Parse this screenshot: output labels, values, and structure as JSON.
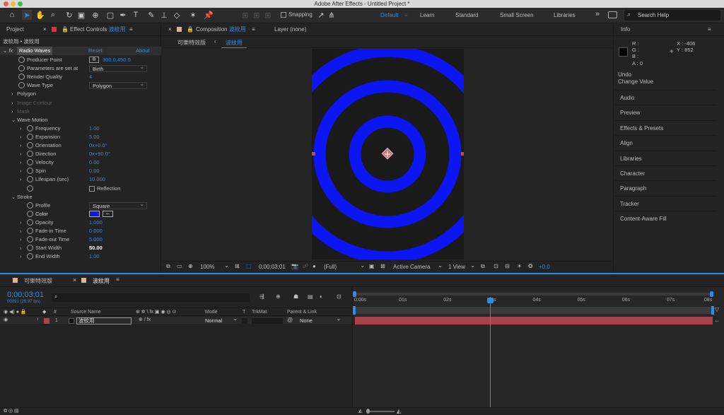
{
  "window": {
    "title": "Adobe After Effects - Untitled Project *"
  },
  "toolbar": {
    "snapping": "Snapping",
    "workspaces": [
      "Default",
      "Learn",
      "Standard",
      "Small Screen",
      "Libraries"
    ],
    "more": "»",
    "search": "Search Help"
  },
  "project_tab": "Project",
  "effect_tab": {
    "prefix": "Effect Controls",
    "comp": "波紋用"
  },
  "comp_panel": {
    "tab_prefix": "Composition",
    "tab_name": "波紋用",
    "layer": "Layer (none)",
    "breadcrumb": [
      "可樂特效版",
      "波紋用"
    ]
  },
  "effect": {
    "header": "波紋用 • 波紋用",
    "name": "Radio Waves",
    "reset": "Reset",
    "about": "About",
    "rows": [
      {
        "label": "Producer Point",
        "value": "300.0,450.0"
      },
      {
        "label": "Parameters are set at",
        "value": "Birth"
      },
      {
        "label": "Render Quality",
        "value": "4"
      },
      {
        "label": "Wave Type",
        "value": "Polygon"
      },
      {
        "label": "Polygon"
      },
      {
        "label": "Image Contour"
      },
      {
        "label": "Mask"
      },
      {
        "label": "Wave Motion"
      },
      {
        "label": "Frequency",
        "value": "1.00"
      },
      {
        "label": "Expansion",
        "value": "5.00"
      },
      {
        "label": "Orientation",
        "value": "0x+0.0°"
      },
      {
        "label": "Direction",
        "value": "0x+90.0°"
      },
      {
        "label": "Velocity",
        "value": "0.00"
      },
      {
        "label": "Spin",
        "value": "0.00"
      },
      {
        "label": "Lifespan (sec)",
        "value": "10.000"
      },
      {
        "label": "Reflection"
      },
      {
        "label": "Stroke"
      },
      {
        "label": "Profile",
        "value": "Square"
      },
      {
        "label": "Color"
      },
      {
        "label": "Opacity",
        "value": "1.000"
      },
      {
        "label": "Fade-in Time",
        "value": "0.000"
      },
      {
        "label": "Fade-out Time",
        "value": "5.000"
      },
      {
        "label": "Start Width",
        "value": "50.00"
      },
      {
        "label": "End Width",
        "value": "1.00"
      }
    ]
  },
  "viewer": {
    "zoom": "100%",
    "timecode": "0;00;03;01",
    "resolution": "(Full)",
    "camera": "Active Camera",
    "view": "1 View",
    "exposure": "+0.0"
  },
  "info": {
    "title": "Info",
    "r": "R :",
    "g": "G :",
    "b": "B :",
    "a": "A :  0",
    "x": "X : -406",
    "y": "Y :  852",
    "undo": "Undo",
    "undo_action": "Change Value"
  },
  "right_panels": [
    "Audio",
    "Preview",
    "Effects & Presets",
    "Align",
    "Libraries",
    "Character",
    "Paragraph",
    "Tracker",
    "Content-Aware Fill"
  ],
  "timeline": {
    "tabs": [
      "可樂特效版",
      "波紋用"
    ],
    "timecode": "0;00;03;01",
    "fps": "00091 (29.97 fps)",
    "cols": {
      "num": "#",
      "source": "Source Name",
      "mode": "Mode",
      "t": "T",
      "trkmat": "TrkMat",
      "parent": "Parent & Link"
    },
    "layer": {
      "index": "1",
      "name": "波紋用",
      "mode": "Normal",
      "parent": "None"
    },
    "ruler": [
      "0:00s",
      "01s",
      "02s",
      "03s",
      "04s",
      "05s",
      "06s",
      "07s",
      "08s"
    ]
  },
  "colors": {
    "wave": "#0b16f2",
    "accent": "#2d8ceb",
    "layer_bar": "#a9424b"
  }
}
